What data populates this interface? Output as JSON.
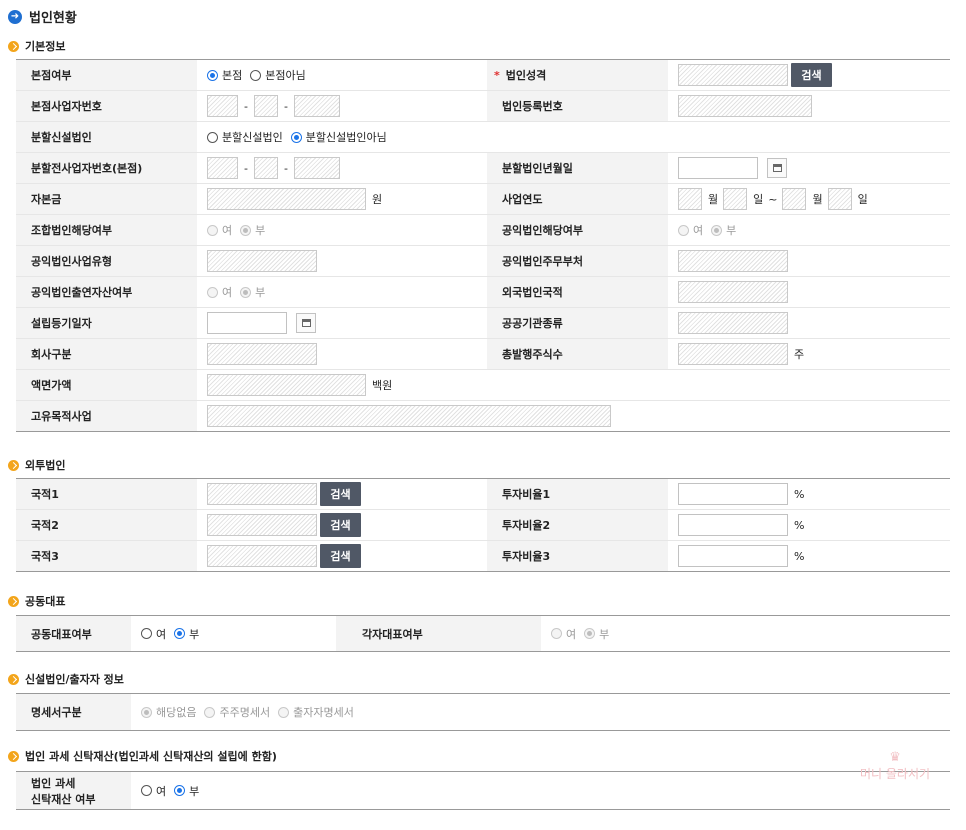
{
  "page_title": "법인현황",
  "sections": {
    "basic": "기본정보",
    "foreign": "외투법인",
    "joint": "공동대표",
    "new_corp": "신설법인/출자자 정보",
    "trust": "법인 과세 신탁재산(법인과세 신탁재산의 설립에 한함)"
  },
  "basic": {
    "hq_label": "본점여부",
    "hq_opts": [
      "본점",
      "본점아님"
    ],
    "corp_nature_label": "법인성격",
    "search_btn": "검색",
    "hq_bizno_label": "본점사업자번호",
    "corp_regno_label": "법인등록번호",
    "split_label": "분할신설법인",
    "split_opts": [
      "분할신설법인",
      "분할신설법인아님"
    ],
    "pre_split_bizno_label": "분할전사업자번호(본점)",
    "split_date_label": "분할법인년월일",
    "capital_label": "자본금",
    "capital_unit": "원",
    "biz_year_label": "사업연도",
    "month": "월",
    "day": "일",
    "tilde": "~",
    "dash": "-",
    "union_label": "조합법인해당여부",
    "public_label": "공익법인해당여부",
    "yes": "여",
    "no": "부",
    "public_type_label": "공익법인사업유형",
    "public_ministry_label": "공익법인주무부처",
    "public_contrib_label": "공익법인출연자산여부",
    "foreign_nat_label": "외국법인국적",
    "est_date_label": "설립등기일자",
    "public_inst_label": "공공기관종류",
    "company_type_label": "회사구분",
    "total_shares_label": "총발행주식수",
    "shares_unit": "주",
    "par_value_label": "액면가액",
    "par_value_unit": "백원",
    "unique_biz_label": "고유목적사업"
  },
  "foreign": {
    "rows": [
      {
        "nat": "국적1",
        "ratio": "투자비율1"
      },
      {
        "nat": "국적2",
        "ratio": "투자비율2"
      },
      {
        "nat": "국적3",
        "ratio": "투자비율3"
      }
    ],
    "search_btn": "검색",
    "pct": "%"
  },
  "joint": {
    "joint_rep_label": "공동대표여부",
    "each_rep_label": "각자대표여부",
    "yes": "여",
    "no": "부"
  },
  "new_corp": {
    "statement_label": "명세서구분",
    "opts": [
      "해당없음",
      "주주명세서",
      "출자자명세서"
    ]
  },
  "trust": {
    "label_line1": "법인 과세",
    "label_line2": "신탁재산 여부",
    "yes": "여",
    "no": "부"
  },
  "watermark": "머니 올라서기"
}
